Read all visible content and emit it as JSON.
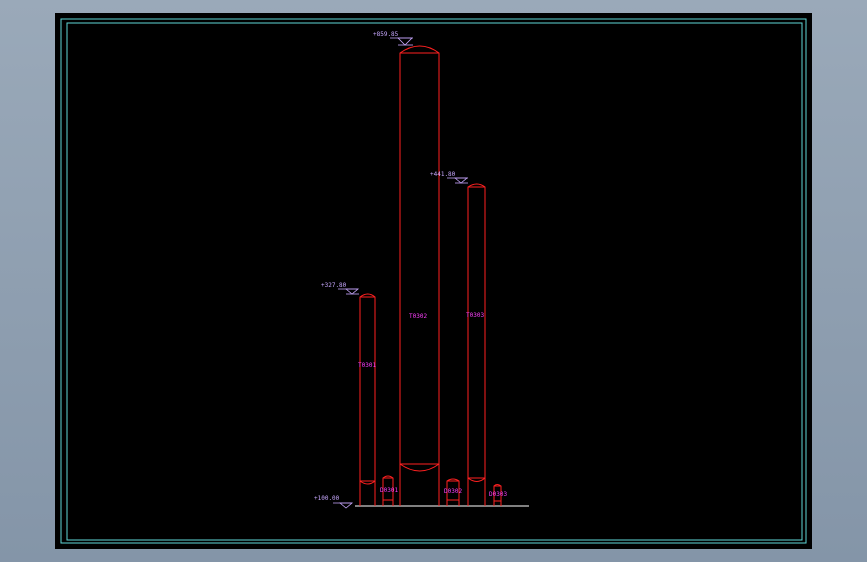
{
  "drawing": {
    "background": "#000000",
    "frame_color": "#5fd7d7",
    "vessel_color": "#ff2020",
    "tag_color": "#ff40ff",
    "elevation_color": "#c8a8ff",
    "ground_color": "#ffffff",
    "elevations": {
      "T0302_top": "+859.85",
      "T0303_top": "+441.80",
      "T0301_top": "+327.80",
      "ground": "+100.00"
    },
    "tags": {
      "T0301": "T0301",
      "T0302": "T0302",
      "T0303": "T0303",
      "D0301": "D0301",
      "D0302": "D0302",
      "D0303": "D0303"
    }
  }
}
